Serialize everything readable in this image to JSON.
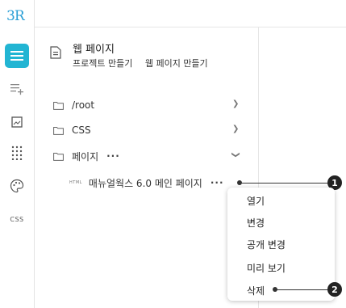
{
  "app": {
    "logo": "3R"
  },
  "rail": {
    "items": [
      {
        "icon": "menu-icon"
      },
      {
        "icon": "list-add-icon"
      },
      {
        "icon": "image-icon"
      },
      {
        "icon": "grid-dots-icon"
      },
      {
        "icon": "palette-icon"
      },
      {
        "icon": "css-icon",
        "label": "CSS"
      }
    ]
  },
  "header": {
    "title": "웹 페이지",
    "breadcrumbs": [
      "프로젝트 만들기",
      "웹 페이지 만들기"
    ]
  },
  "tree": {
    "items": [
      {
        "label": "/root"
      },
      {
        "label": "CSS"
      },
      {
        "label": "페이지",
        "more": "···"
      }
    ],
    "file": {
      "tag": "HTML",
      "label": "매뉴얼웍스 6.0 메인 페이지",
      "more": "···"
    }
  },
  "context_menu": {
    "items": [
      "열기",
      "변경",
      "공개 변경",
      "미리 보기",
      "삭제"
    ]
  },
  "callouts": [
    "1",
    "2"
  ]
}
